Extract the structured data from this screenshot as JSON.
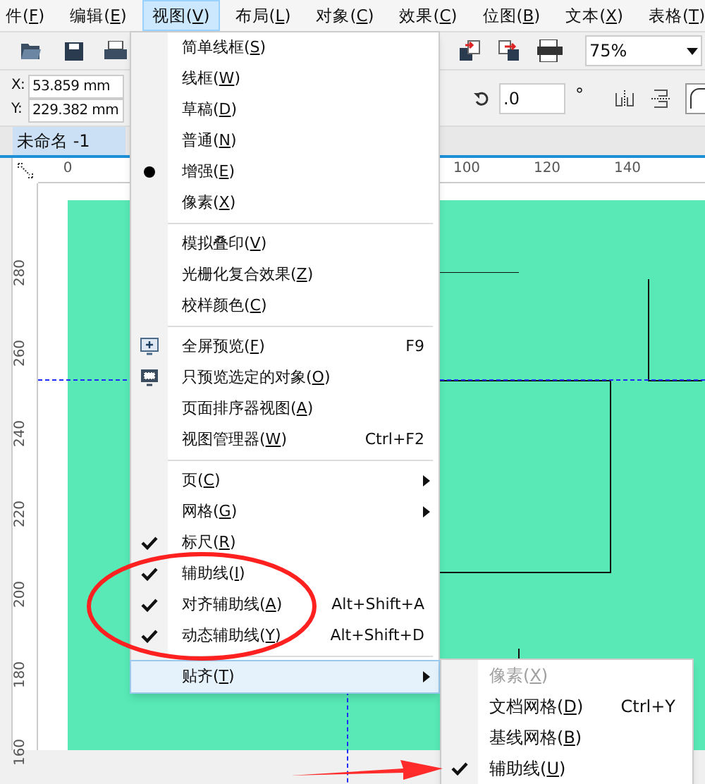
{
  "menubar": [
    {
      "label": "件(F)",
      "selected": false
    },
    {
      "label": "编辑(E)",
      "selected": false
    },
    {
      "label": "视图(V)",
      "selected": true
    },
    {
      "label": "布局(L)",
      "selected": false
    },
    {
      "label": "对象(C)",
      "selected": false
    },
    {
      "label": "效果(C)",
      "selected": false
    },
    {
      "label": "位图(B)",
      "selected": false
    },
    {
      "label": "文本(X)",
      "selected": false
    },
    {
      "label": "表格(T)",
      "selected": false
    }
  ],
  "toolbar": {
    "zoom": "75%"
  },
  "property_bar": {
    "x_label": "X:",
    "x_value": "53.859 mm",
    "y_label": "Y:",
    "y_value": "229.382 mm",
    "rotation": ".0",
    "degree": "°"
  },
  "document_tab": {
    "title": "未命名 -1",
    "selected": true
  },
  "horizontal_ruler": [
    "0",
    "100",
    "120",
    "140"
  ],
  "vertical_ruler": [
    "280",
    "260",
    "240",
    "220",
    "200",
    "180",
    "160"
  ],
  "view_menu": [
    {
      "kind": "radio",
      "label": "简单线框(S)",
      "checked": false,
      "selected": false
    },
    {
      "kind": "radio",
      "label": "线框(W)",
      "checked": false,
      "selected": false
    },
    {
      "kind": "radio",
      "label": "草稿(D)",
      "checked": false,
      "selected": false
    },
    {
      "kind": "radio",
      "label": "普通(N)",
      "checked": false,
      "selected": false
    },
    {
      "kind": "radio",
      "label": "增强(E)",
      "checked": true,
      "selected": false
    },
    {
      "kind": "radio",
      "label": "像素(X)",
      "checked": false,
      "selected": false
    },
    {
      "kind": "separator"
    },
    {
      "kind": "check",
      "label": "模拟叠印(V)",
      "checked": false,
      "selected": false
    },
    {
      "kind": "check",
      "label": "光栅化复合效果(Z)",
      "checked": false,
      "selected": false
    },
    {
      "kind": "check",
      "label": "校样颜色(C)",
      "checked": false,
      "selected": false
    },
    {
      "kind": "separator"
    },
    {
      "kind": "fullscreen",
      "label": "全屏预览(F)",
      "shortcut": "F9",
      "selected": false
    },
    {
      "kind": "preview-selected",
      "label": "只预览选定的对象(O)",
      "selected": false
    },
    {
      "kind": "command",
      "label": "页面排序器视图(A)",
      "selected": false
    },
    {
      "kind": "command",
      "label": "视图管理器(W)",
      "shortcut": "Ctrl+F2",
      "selected": false
    },
    {
      "kind": "separator"
    },
    {
      "kind": "submenu",
      "label": "页(C)",
      "selected": false
    },
    {
      "kind": "submenu",
      "label": "网格(G)",
      "selected": false
    },
    {
      "kind": "check",
      "label": "标尺(R)",
      "checked": true,
      "selected": false
    },
    {
      "kind": "check",
      "label": "辅助线(I)",
      "checked": true,
      "selected": false
    },
    {
      "kind": "check",
      "label": "对齐辅助线(A)",
      "shortcut": "Alt+Shift+A",
      "checked": true,
      "selected": false
    },
    {
      "kind": "check",
      "label": "动态辅助线(Y)",
      "shortcut": "Alt+Shift+D",
      "checked": true,
      "selected": false
    },
    {
      "kind": "separator"
    },
    {
      "kind": "submenu",
      "label": "贴齐(T)",
      "selected": true
    }
  ],
  "snap_submenu": [
    {
      "label": "像素(X)",
      "disabled": true,
      "checked": false
    },
    {
      "label": "文档网格(D)",
      "shortcut": "Ctrl+Y",
      "disabled": false,
      "checked": false
    },
    {
      "label": "基线网格(B)",
      "disabled": false,
      "checked": false
    },
    {
      "label": "辅助线(U)",
      "disabled": false,
      "checked": true
    }
  ]
}
